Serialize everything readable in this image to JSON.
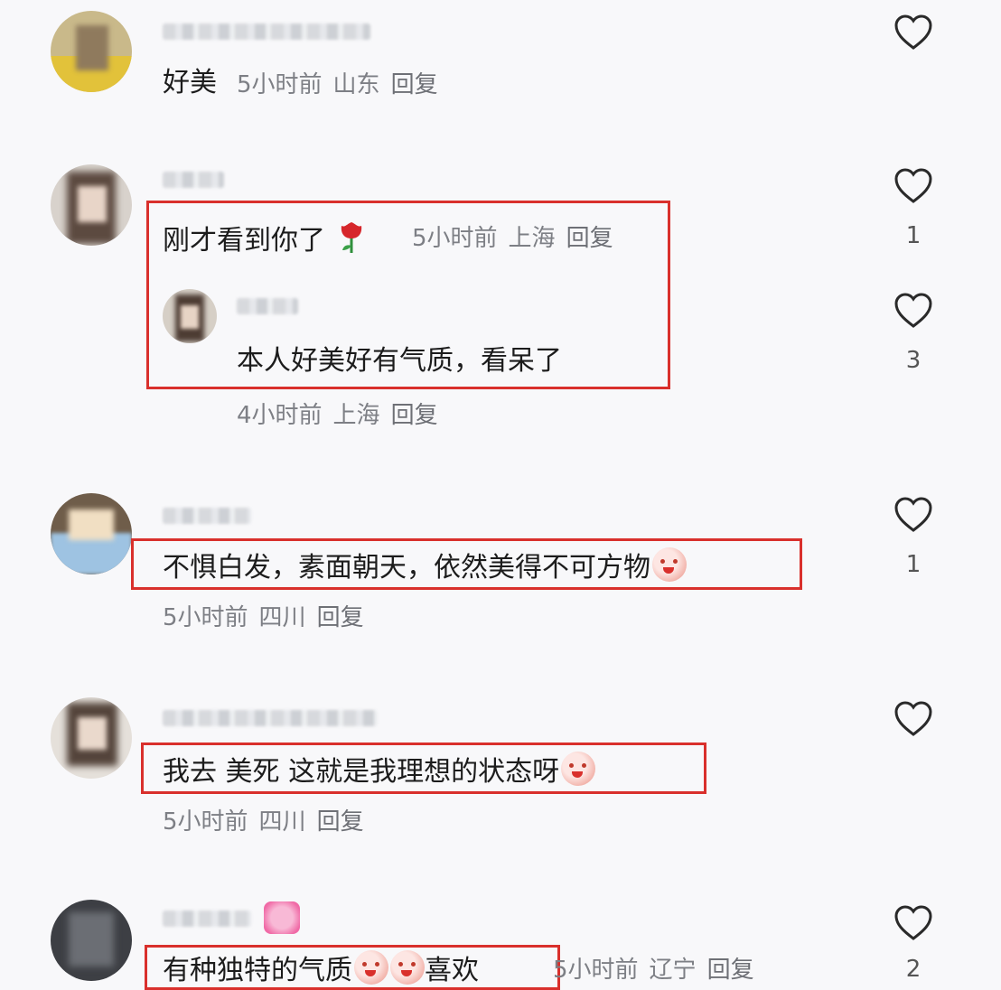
{
  "comments": [
    {
      "text": "好美",
      "time": "5小时前",
      "location": "山东",
      "reply": "回复",
      "likes": ""
    },
    {
      "text": "刚才看到你了",
      "time": "5小时前",
      "location": "上海",
      "reply": "回复",
      "likes": "1",
      "sub_reply": {
        "text": "本人好美好有气质，看呆了",
        "time": "4小时前",
        "location": "上海",
        "reply": "回复",
        "likes": "3"
      }
    },
    {
      "text": "不惧白发，素面朝天，依然美得不可方物",
      "time": "5小时前",
      "location": "四川",
      "reply": "回复",
      "likes": "1"
    },
    {
      "text": "我去 美死 这就是我理想的状态呀",
      "time": "5小时前",
      "location": "四川",
      "reply": "回复",
      "likes": ""
    },
    {
      "text": "有种独特的气质",
      "text_after": "喜欢",
      "time": "5小时前",
      "location": "辽宁",
      "reply": "回复",
      "likes": "2"
    }
  ],
  "colors": {
    "highlight_box": "#d9302c",
    "meta_text": "#7d7f85",
    "background": "#f8f8fa"
  },
  "icons": {
    "like": "heart-outline-icon",
    "rose": "rose-emoji-icon",
    "emoji": "blush-face-emoji-icon"
  }
}
